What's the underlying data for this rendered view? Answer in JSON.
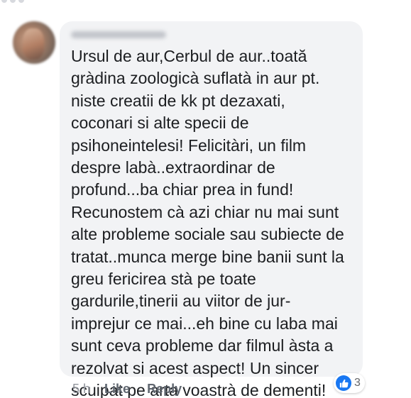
{
  "comment": {
    "author_name_hidden": true,
    "lines": [
      "Ursul de aur,Cerbul de aur..toată",
      "gràdina zoologicà suflatà in aur pt.",
      "niste creatii de kk pt dezaxati,",
      "coconari si alte specii de",
      "psihoneintelesi! Felicitàri, un film",
      "despre labà..extraordinar de",
      "profund...ba chiar prea in fund!",
      "Recunostem cà azi chiar nu mai sunt",
      "alte probleme sociale sau subiecte de",
      "tratat..munca merge bine banii sunt la",
      "greu fericirea stà pe toate",
      "gardurile,tinerii au viitor de jur-",
      "imprejur ce mai...eh bine cu laba mai",
      "sunt ceva probleme dar filmul àsta a",
      "rezolvat si acest aspect! Un sincer",
      "scuipat pe arta voastrà de dementi!"
    ]
  },
  "actions": {
    "time": "5 h",
    "like_label": "Like",
    "reply_label": "Reply"
  },
  "reactions": {
    "icon": "like-icon",
    "count": "3",
    "color": "#1877f2"
  },
  "colors": {
    "bubble": "#f2f3f5",
    "text": "#1c1e21",
    "action_text": "#606770",
    "timestamp": "#90949c"
  }
}
